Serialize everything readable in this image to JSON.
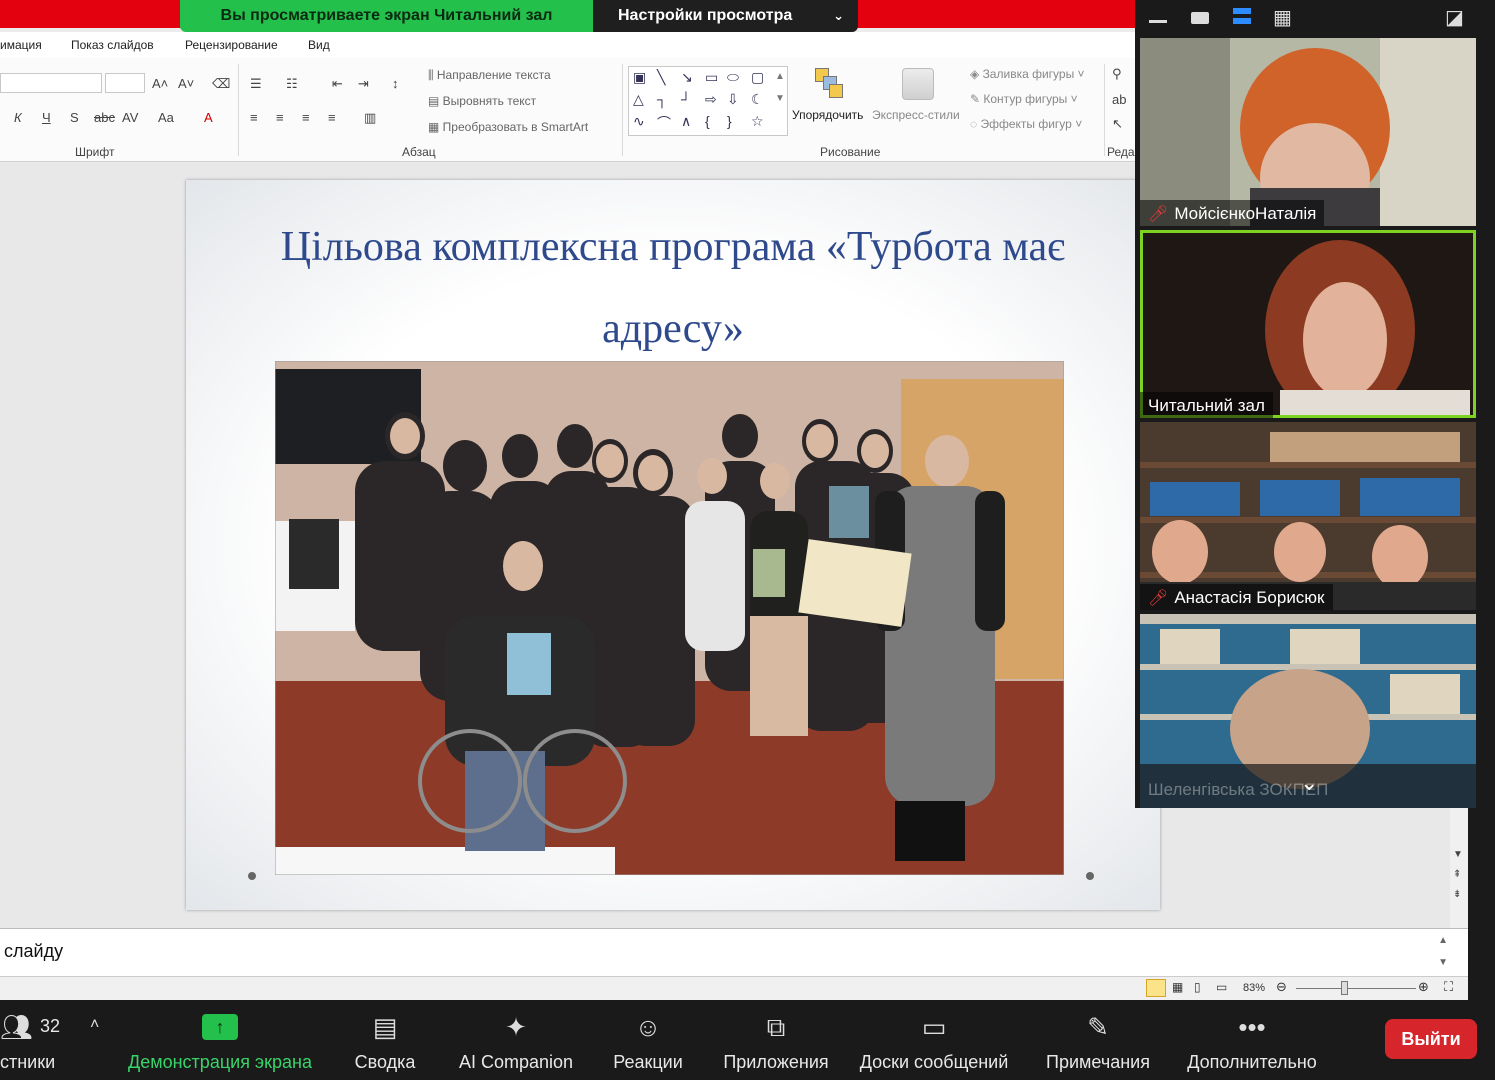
{
  "share_banner": {
    "viewing_text": "Вы просматриваете экран Читальний зал",
    "view_options_label": "Настройки просмотра"
  },
  "ppt": {
    "tabs": [
      "имация",
      "Показ слайдов",
      "Рецензирование",
      "Вид"
    ],
    "groups": {
      "font": "Шрифт",
      "paragraph": "Абзац",
      "drawing": "Рисование",
      "editing": "Реда"
    },
    "paragraph_items": [
      "Направление текста",
      "Выровнять текст",
      "Преобразовать в SmartArt"
    ],
    "drawing_items": {
      "arrange": "Упорядочить",
      "quick_styles": "Экспресс-стили",
      "fill": "Заливка фигуры",
      "outline": "Контур фигуры",
      "effects": "Эффекты фигур"
    },
    "slide_title": "Цільова комплексна програма «Турбота має адресу»",
    "notes_text": "слайду",
    "zoom_level": "83%"
  },
  "participants": [
    {
      "name": "МойсієнкоНаталія",
      "muted": true
    },
    {
      "name": "Читальний зал",
      "muted": false,
      "active": true
    },
    {
      "name": "Анастасія Борисюк",
      "muted": true
    },
    {
      "name": "Шеленгівська ЗОКПЕП",
      "muted": false
    }
  ],
  "toolbar": {
    "participants_count": "32",
    "participants_label": "стники",
    "share_label": "Демонстрация экрана",
    "summary_label": "Сводка",
    "ai_label": "AI Companion",
    "reactions_label": "Реакции",
    "apps_label": "Приложения",
    "boards_label": "Доски сообщений",
    "notes_label": "Примечания",
    "more_label": "Дополнительно",
    "leave_label": "Выйти"
  },
  "colors": {
    "share_frame": "#e3000f",
    "banner_green": "#24c04c",
    "active_speaker": "#7ed321",
    "leave": "#d7262b",
    "slide_title": "#2f4a8c"
  }
}
